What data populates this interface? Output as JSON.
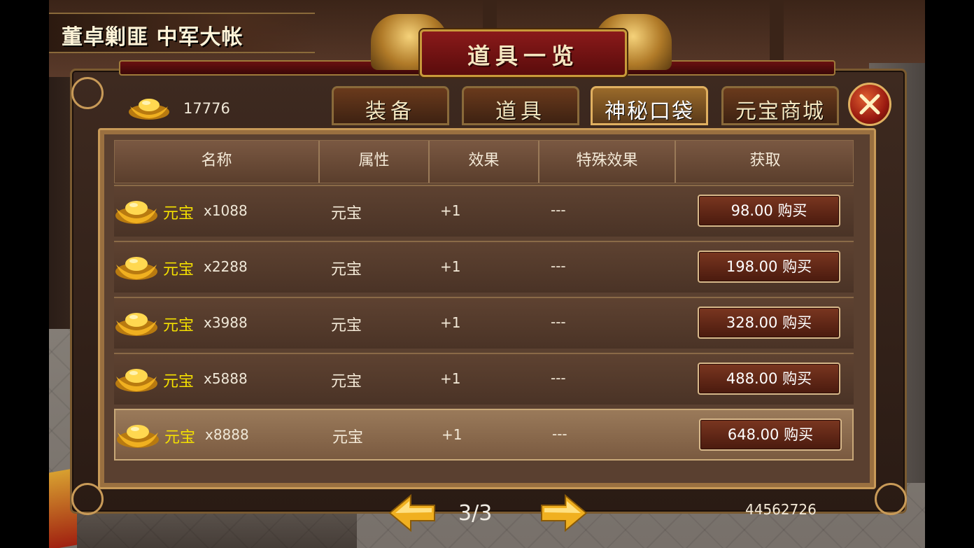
{
  "location_title": "董卓剿匪 中军大帐",
  "banner_title": "道具一览",
  "currency": {
    "icon": "gold-ingot-icon",
    "amount": "17776"
  },
  "tabs": [
    {
      "label": "装备",
      "active": false
    },
    {
      "label": "道具",
      "active": false
    },
    {
      "label": "神秘口袋",
      "active": true
    },
    {
      "label": "元宝商城",
      "active": false
    }
  ],
  "table": {
    "headers": [
      "名称",
      "属性",
      "效果",
      "特殊效果",
      "获取"
    ],
    "rows": [
      {
        "name": "元宝",
        "qty": "x1088",
        "attr": "元宝",
        "effect": "+1",
        "special": "---",
        "buy": "98.00 购买"
      },
      {
        "name": "元宝",
        "qty": "x2288",
        "attr": "元宝",
        "effect": "+1",
        "special": "---",
        "buy": "198.00 购买"
      },
      {
        "name": "元宝",
        "qty": "x3988",
        "attr": "元宝",
        "effect": "+1",
        "special": "---",
        "buy": "328.00 购买"
      },
      {
        "name": "元宝",
        "qty": "x5888",
        "attr": "元宝",
        "effect": "+1",
        "special": "---",
        "buy": "488.00 购买"
      },
      {
        "name": "元宝",
        "qty": "x8888",
        "attr": "元宝",
        "effect": "+1",
        "special": "---",
        "buy": "648.00 购买"
      }
    ]
  },
  "pager": "3/3",
  "player_id": "44562726",
  "colors": {
    "gold_text": "#f4e000",
    "panel_border": "#c89a58",
    "buy_button": "#7a3620"
  }
}
